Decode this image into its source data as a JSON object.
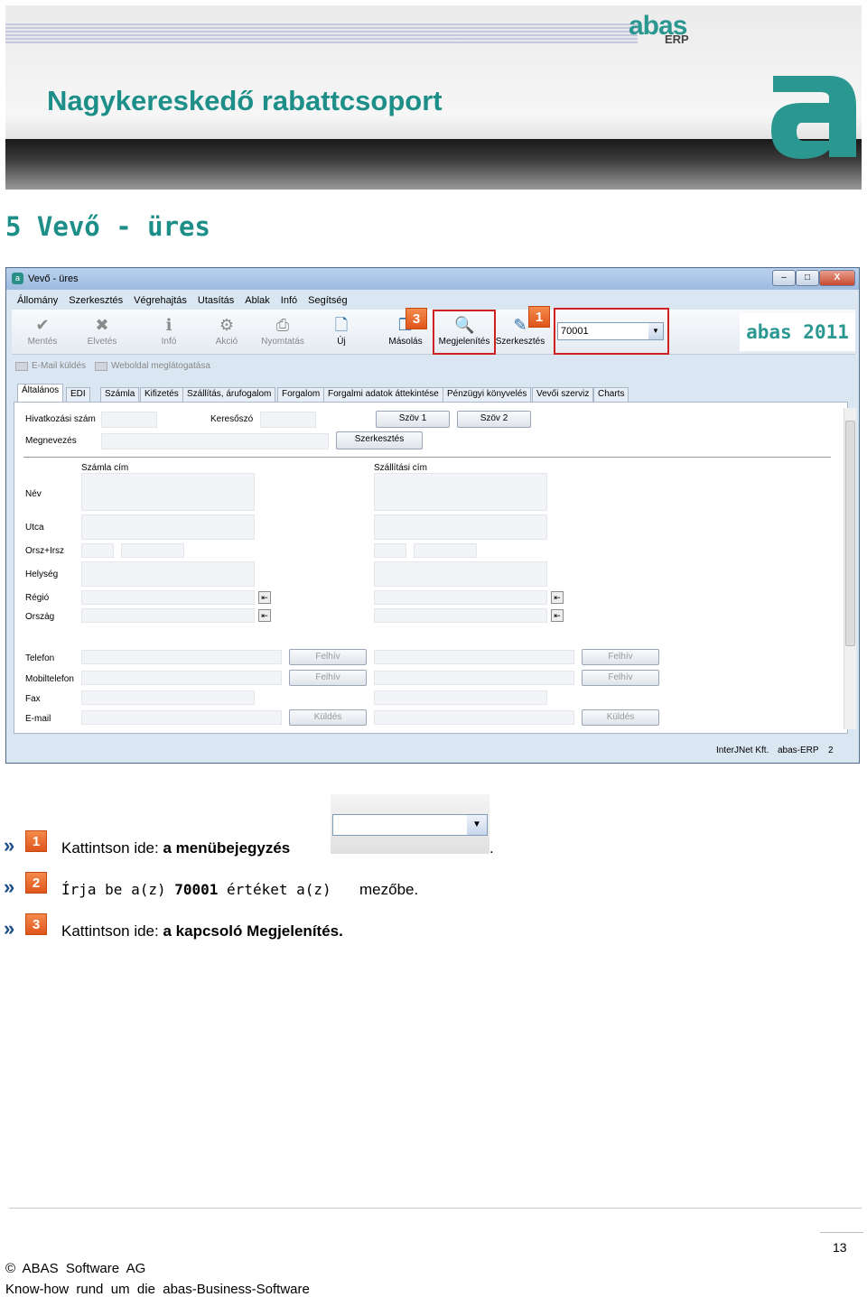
{
  "banner": {
    "title": "Nagykereskedő rabattcsoport",
    "logo_text": "abas",
    "logo_sub": "ERP",
    "logo_big": "a"
  },
  "section_title": "5  Vevő - üres",
  "window": {
    "title": "Vevő - üres",
    "buttons": [
      "–",
      "□",
      "X"
    ],
    "menu": [
      "Állomány",
      "Szerkesztés",
      "Végrehajtás",
      "Utasítás",
      "Ablak",
      "Infó",
      "Segítség"
    ],
    "toolbar": {
      "mentes": "Mentés",
      "elvetes": "Elvetés",
      "info": "Infó",
      "akcio": "Akció",
      "nyomtatas": "Nyomtatás",
      "uj": "Új",
      "masolas": "Másolás",
      "megjelenites": "Megjelenítés",
      "szerkesztes": "Szerkesztés",
      "search_value": "70001",
      "brand": "abas 2011"
    },
    "row2": {
      "email": "E-Mail küldés",
      "web": "Weboldal meglátogatása"
    },
    "tabs": [
      "Általános",
      "EDI",
      "Számla",
      "Kifizetés",
      "Szállítás, árufogalom",
      "Forgalom",
      "Forgalmi adatok áttekintése",
      "Pénzügyi könyvelés",
      "Vevői szerviz",
      "Charts"
    ],
    "form": {
      "hivatkozasi": "Hivatkozási szám",
      "keresoszo": "Keresőszó",
      "szov1": "Szöv 1",
      "szov2": "Szöv 2",
      "megnevezes": "Megnevezés",
      "szerkesztes": "Szerkesztés",
      "szamla_cim": "Számla cím",
      "szallitasi_cim": "Szállítási cím",
      "nev": "Név",
      "utca": "Utca",
      "orsz": "Orsz+Irsz",
      "helyseg": "Helység",
      "regio": "Régió",
      "orszag": "Ország",
      "telefon": "Telefon",
      "mobil": "Mobiltelefon",
      "fax": "Fax",
      "email": "E-mail",
      "felhiv": "Felhív",
      "kuldes": "Küldés"
    },
    "status": {
      "left": "InterJNet Kft.",
      "mid": "abas-ERP",
      "num": "2"
    }
  },
  "badges": {
    "one": "1",
    "two": "2",
    "three": "3"
  },
  "steps": {
    "arrow": "»",
    "s1_pre": "Kattintson  ide:",
    "s1_bold": "a menübejegyzés",
    "s1_post": ".",
    "s2_pre": "Írja  be  a(z)",
    "s2_value": "70001",
    "s2_mid": "értéket  a(z)",
    "s2_post": "mezőbe.",
    "s3_pre": "Kattintson  ide:",
    "s3_bold": "a kapcsoló Megjelenítés."
  },
  "footer": {
    "page": "13",
    "copyright": "©  ABAS  Software  AG",
    "tagline": "Know-how  rund  um  die  abas-Business-Software"
  }
}
